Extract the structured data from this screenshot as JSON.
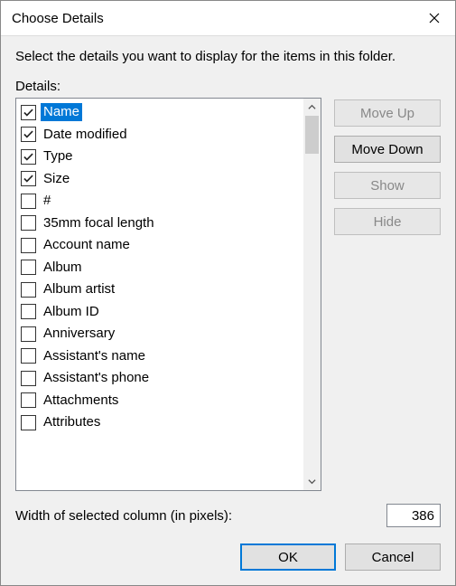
{
  "title": "Choose Details",
  "instruction": "Select the details you want to display for the items in this folder.",
  "details_label": "Details:",
  "items": [
    {
      "label": "Name",
      "checked": true,
      "selected": true
    },
    {
      "label": "Date modified",
      "checked": true,
      "selected": false
    },
    {
      "label": "Type",
      "checked": true,
      "selected": false
    },
    {
      "label": "Size",
      "checked": true,
      "selected": false
    },
    {
      "label": "#",
      "checked": false,
      "selected": false
    },
    {
      "label": "35mm focal length",
      "checked": false,
      "selected": false
    },
    {
      "label": "Account name",
      "checked": false,
      "selected": false
    },
    {
      "label": "Album",
      "checked": false,
      "selected": false
    },
    {
      "label": "Album artist",
      "checked": false,
      "selected": false
    },
    {
      "label": "Album ID",
      "checked": false,
      "selected": false
    },
    {
      "label": "Anniversary",
      "checked": false,
      "selected": false
    },
    {
      "label": "Assistant's name",
      "checked": false,
      "selected": false
    },
    {
      "label": "Assistant's phone",
      "checked": false,
      "selected": false
    },
    {
      "label": "Attachments",
      "checked": false,
      "selected": false
    },
    {
      "label": "Attributes",
      "checked": false,
      "selected": false
    }
  ],
  "side_buttons": {
    "move_up": {
      "label": "Move Up",
      "enabled": false
    },
    "move_down": {
      "label": "Move Down",
      "enabled": true
    },
    "show": {
      "label": "Show",
      "enabled": false
    },
    "hide": {
      "label": "Hide",
      "enabled": false
    }
  },
  "width_label": "Width of selected column (in pixels):",
  "width_value": "386",
  "footer": {
    "ok": "OK",
    "cancel": "Cancel"
  }
}
